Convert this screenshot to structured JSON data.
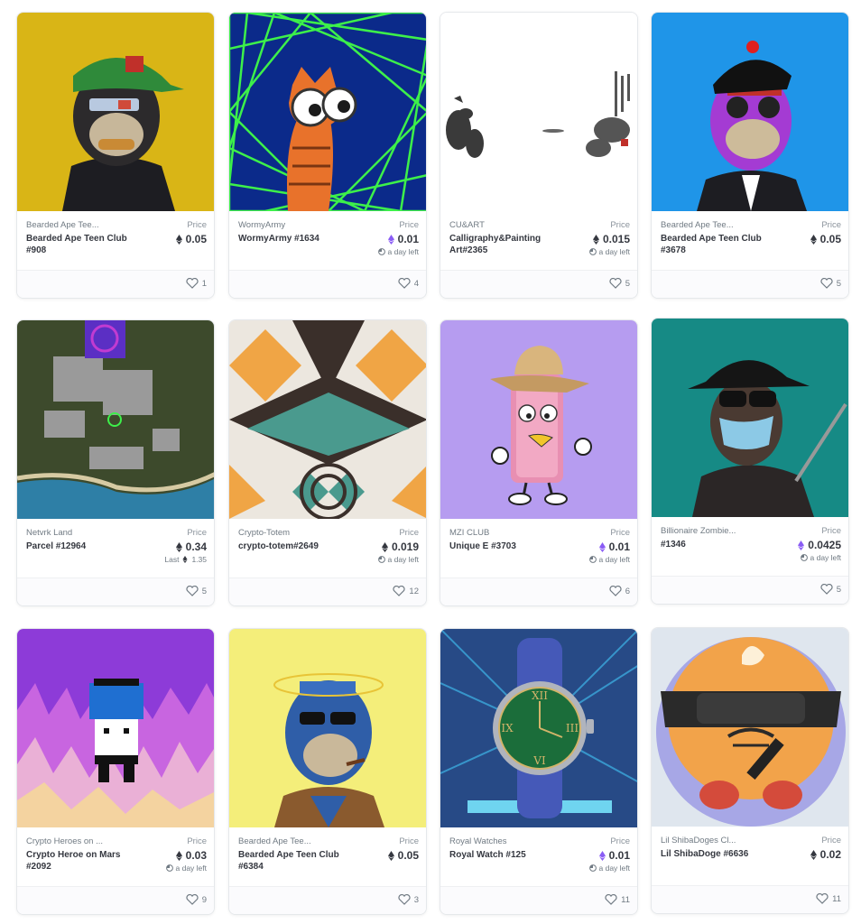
{
  "labels": {
    "price": "Price",
    "last": "Last",
    "time_left": "a day left"
  },
  "cards": [
    {
      "collection": "Bearded Ape Tee...",
      "name": "Bearded Ape Teen Club #908",
      "price": "0.05",
      "currency": "eth",
      "likes": "1"
    },
    {
      "collection": "WormyArmy",
      "name": "WormyArmy #1634",
      "price": "0.01",
      "currency": "weth",
      "time_left": "a day left",
      "likes": "4"
    },
    {
      "collection": "CU&ART",
      "name": "Calligraphy&Painting Art#2365",
      "price": "0.015",
      "currency": "eth",
      "time_left": "a day left",
      "likes": "5"
    },
    {
      "collection": "Bearded Ape Tee...",
      "name": "Bearded Ape Teen Club #3678",
      "price": "0.05",
      "currency": "eth",
      "likes": "5"
    },
    {
      "collection": "Netvrk Land",
      "name": "Parcel #12964",
      "price": "0.34",
      "currency": "eth",
      "last_price": "1.35",
      "likes": "5"
    },
    {
      "collection": "Crypto-Totem",
      "name": "crypto-totem#2649",
      "price": "0.019",
      "currency": "eth",
      "time_left": "a day left",
      "likes": "12"
    },
    {
      "collection": "MZI CLUB",
      "name": "Unique E #3703",
      "price": "0.01",
      "currency": "weth",
      "time_left": "a day left",
      "likes": "6"
    },
    {
      "collection": "Billionaire Zombie...",
      "name": "#1346",
      "price": "0.0425",
      "currency": "weth",
      "time_left": "a day left",
      "likes": "5"
    },
    {
      "collection": "Crypto Heroes on ...",
      "name": "Crypto Heroe on Mars #2092",
      "price": "0.03",
      "currency": "eth",
      "time_left": "a day left",
      "likes": "9"
    },
    {
      "collection": "Bearded Ape Tee...",
      "name": "Bearded Ape Teen Club #6384",
      "price": "0.05",
      "currency": "eth",
      "likes": "3"
    },
    {
      "collection": "Royal Watches",
      "name": "Royal Watch #125",
      "price": "0.01",
      "currency": "weth",
      "time_left": "a day left",
      "likes": "11"
    },
    {
      "collection": "Lil ShibaDoges Cl...",
      "name": "Lil ShibaDoge #6636",
      "price": "0.02",
      "currency": "eth",
      "likes": "11"
    }
  ],
  "colors": {
    "eth": "#353840",
    "weth": "#8a5cf5",
    "text_muted": "#707a83",
    "border": "#e5e8eb"
  }
}
